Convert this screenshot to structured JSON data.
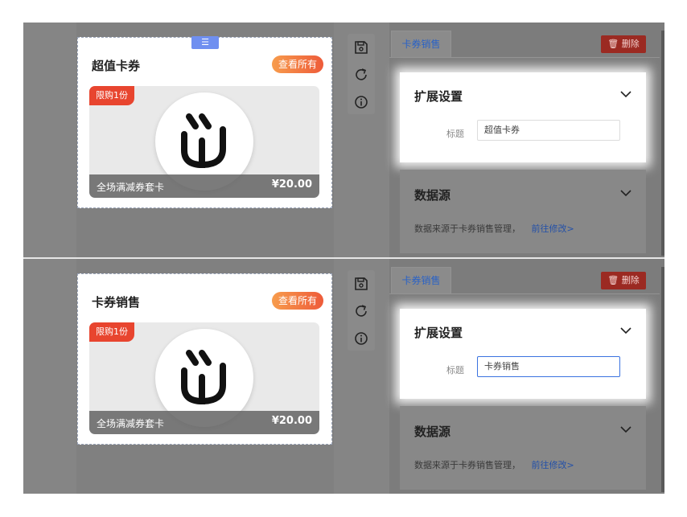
{
  "panels": [
    {
      "widget": {
        "title": "超值卡券",
        "view_all": "查看所有",
        "card": {
          "badge": "限购1份",
          "name": "全场满减券套卡",
          "price": "¥20.00"
        }
      },
      "settings": {
        "tab_label": "卡券销售",
        "delete_label": "删除",
        "extension": {
          "title": "扩展设置",
          "field_label": "标题",
          "field_value": "超值卡券"
        },
        "datasource": {
          "title": "数据源",
          "text": "数据来源于卡券销售管理，",
          "link": "前往修改>"
        }
      }
    },
    {
      "widget": {
        "title": "卡券销售",
        "view_all": "查看所有",
        "card": {
          "badge": "限购1份",
          "name": "全场满减券套卡",
          "price": "¥20.00"
        }
      },
      "settings": {
        "tab_label": "卡券销售",
        "delete_label": "删除",
        "extension": {
          "title": "扩展设置",
          "field_label": "标题",
          "field_value": "卡券销售"
        },
        "datasource": {
          "title": "数据源",
          "text": "数据来源于卡券销售管理，",
          "link": "前往修改>"
        }
      }
    }
  ],
  "icons": {
    "drag": "menu-icon",
    "save": "save-icon",
    "refresh": "refresh-icon",
    "info": "info-icon",
    "delete": "trash-icon",
    "expand": "chevron-down-icon"
  },
  "colors": {
    "accent": "#3a72e0",
    "danger": "#e8452f",
    "overlay": "#858585"
  }
}
